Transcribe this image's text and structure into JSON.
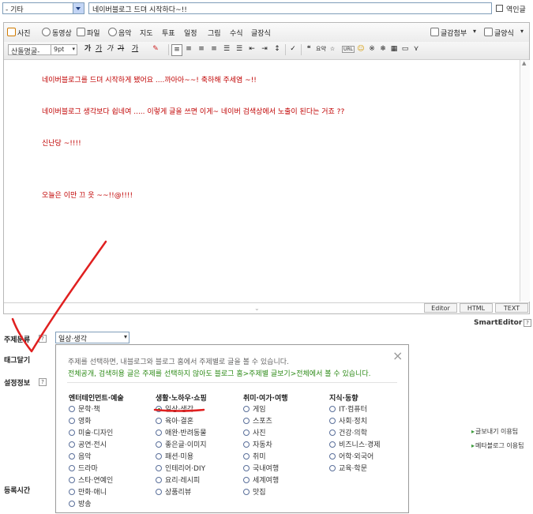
{
  "top_bar": {
    "category_value": "- 기타",
    "title_value": "네이버블로그 드뎌 시작하다~!!",
    "translate_label": "역인글"
  },
  "toolbar1": {
    "photo": "사진",
    "video": "동영상",
    "file": "파일",
    "music": "음악",
    "map": "지도",
    "poll": "투표",
    "schedule": "일정",
    "drawing": "그림",
    "formula": "수식",
    "quote": "글장식",
    "attach": "글감첨부",
    "template": "글양식"
  },
  "toolbar2": {
    "font": "산돌명굴-",
    "size": "9pt",
    "normal": "가",
    "bold": "가",
    "italic": "가",
    "strike": "가",
    "underline": "가",
    "quote_btn": "요약",
    "url_btn": "URL"
  },
  "content": {
    "line1": "네이버블로그를 드뎌 시작하게 됐어요 ....까아아~~! 축하해 주세염 ~!!",
    "line2": "네이버블로그 생각보다 쉽네여 ..... 이렇게 글을 쓰면 이게~ 네이버 검색상에서 노출이 된다는 거죠 ??",
    "line3": "신난당 ~!!!!",
    "line4": "오늘은 이만 끄 읏 ~~!!@!!!!"
  },
  "editor_modes": {
    "editor": "Editor",
    "html": "HTML",
    "text": "TEXT"
  },
  "brand": "SmartEditor™",
  "fields": {
    "topic_label": "주제분류",
    "topic_value": "일상·생각",
    "tag_label": "태그달기",
    "settings_label": "설정정보",
    "time_label": "등록시간",
    "help": "?"
  },
  "right_links": {
    "link1": "글보내기 이용팁",
    "link2": "메타블로그 이용팁"
  },
  "popup": {
    "info1": "주제를 선택하면, 내블로그와 블로그 홈에서 주제별로 글을 볼 수 있습니다.",
    "info2": "전체공개, 검색허용 글은 주제를 선택하지 않아도 블로그 홈>주제별 글보기>전체에서 볼 수 있습니다.",
    "col1_title": "엔터테인먼트·예술",
    "col1": [
      "문학·책",
      "영화",
      "미술·디자인",
      "공연·전시",
      "음악",
      "드라마",
      "스타·연예인",
      "만화·애니",
      "방송"
    ],
    "col2_title": "생활·노하우·쇼핑",
    "col2": [
      "일상·생각",
      "육아·결혼",
      "애완·반려동물",
      "좋은글·이미지",
      "패션·미용",
      "인테리어·DIY",
      "요리·레시피",
      "상품리뷰"
    ],
    "col3_title": "취미·여가·여행",
    "col3": [
      "게임",
      "스포츠",
      "사진",
      "자동차",
      "취미",
      "국내여행",
      "세계여행",
      "맛집"
    ],
    "col4_title": "지식·동향",
    "col4": [
      "IT·컴퓨터",
      "사회·정치",
      "건강·의학",
      "비즈니스·경제",
      "어학·외국어",
      "교육·학문"
    ],
    "selected": "일상·생각"
  },
  "colors": {
    "content_text": "#c00000",
    "info_green": "#2c8a16",
    "annotation_red": "#e02020"
  }
}
